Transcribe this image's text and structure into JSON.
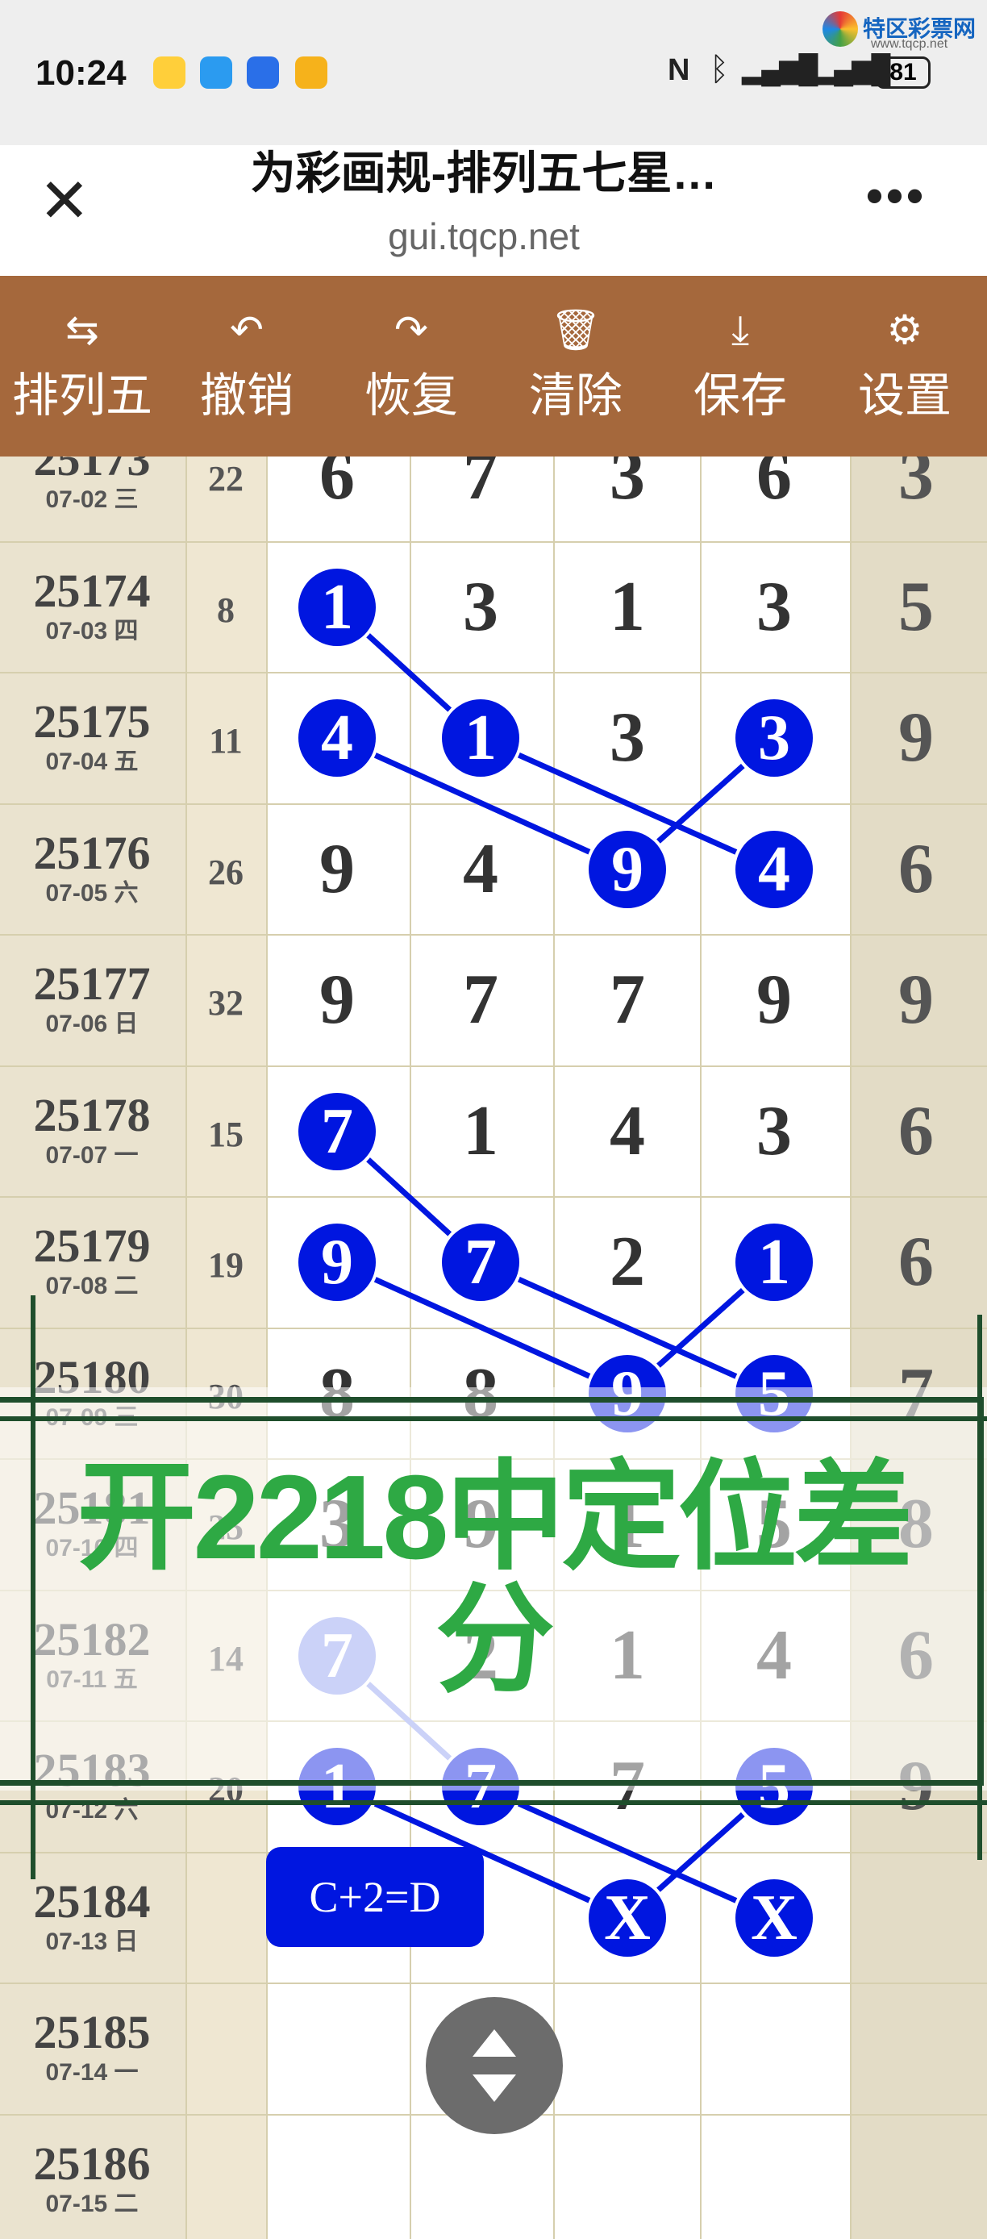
{
  "status": {
    "time": "10:24",
    "battery": "81"
  },
  "brand": {
    "name": "特区彩票网",
    "url": "www.tqcp.net"
  },
  "browser": {
    "title": "为彩画规-排列五七星…",
    "url": "gui.tqcp.net"
  },
  "toolbar": [
    {
      "icon": "⇆",
      "label": "排列五",
      "icon_name": "swap-icon"
    },
    {
      "icon": "↶",
      "label": "撤销",
      "icon_name": "undo-icon"
    },
    {
      "icon": "↷",
      "label": "恢复",
      "icon_name": "redo-icon"
    },
    {
      "icon": "🗑",
      "label": "清除",
      "icon_name": "trash-icon"
    },
    {
      "icon": "⤓",
      "label": "保存",
      "icon_name": "download-icon"
    },
    {
      "icon": "⚙",
      "label": "设置",
      "icon_name": "gear-icon"
    }
  ],
  "rows": [
    {
      "issue": "25173",
      "date": "07-02 三",
      "sum": "22",
      "digits": [
        "6",
        "7",
        "3",
        "6",
        "3"
      ]
    },
    {
      "issue": "25174",
      "date": "07-03 四",
      "sum": "8",
      "digits": [
        "1",
        "3",
        "1",
        "3",
        "5"
      ]
    },
    {
      "issue": "25175",
      "date": "07-04 五",
      "sum": "11",
      "digits": [
        "4",
        "1",
        "3",
        "3",
        "9"
      ]
    },
    {
      "issue": "25176",
      "date": "07-05 六",
      "sum": "26",
      "digits": [
        "9",
        "4",
        "9",
        "4",
        "6"
      ]
    },
    {
      "issue": "25177",
      "date": "07-06 日",
      "sum": "32",
      "digits": [
        "9",
        "7",
        "7",
        "9",
        "9"
      ]
    },
    {
      "issue": "25178",
      "date": "07-07 一",
      "sum": "15",
      "digits": [
        "7",
        "1",
        "4",
        "3",
        "6"
      ]
    },
    {
      "issue": "25179",
      "date": "07-08 二",
      "sum": "19",
      "digits": [
        "9",
        "7",
        "2",
        "1",
        "6"
      ]
    },
    {
      "issue": "25180",
      "date": "07-09 三",
      "sum": "30",
      "digits": [
        "8",
        "8",
        "9",
        "5",
        "7"
      ]
    },
    {
      "issue": "25181",
      "date": "07-10 四",
      "sum": "25",
      "digits": [
        "3",
        "9",
        "1",
        "5",
        "8"
      ]
    },
    {
      "issue": "25182",
      "date": "07-11 五",
      "sum": "14",
      "digits": [
        "7",
        "2",
        "1",
        "4",
        "6"
      ]
    },
    {
      "issue": "25183",
      "date": "07-12 六",
      "sum": "20",
      "digits": [
        "1",
        "7",
        "7",
        "5",
        "9"
      ]
    },
    {
      "issue": "25184",
      "date": "07-13 日",
      "sum": "",
      "digits": [
        "",
        "",
        "X",
        "X",
        ""
      ]
    },
    {
      "issue": "25185",
      "date": "07-14 一",
      "sum": "",
      "digits": [
        "",
        "",
        "",
        "",
        ""
      ]
    },
    {
      "issue": "25186",
      "date": "07-15 二",
      "sum": "",
      "digits": [
        "",
        "",
        "",
        "",
        ""
      ]
    }
  ],
  "overlay": {
    "text": "开2218中定位差分"
  },
  "formula": "C+2=D"
}
